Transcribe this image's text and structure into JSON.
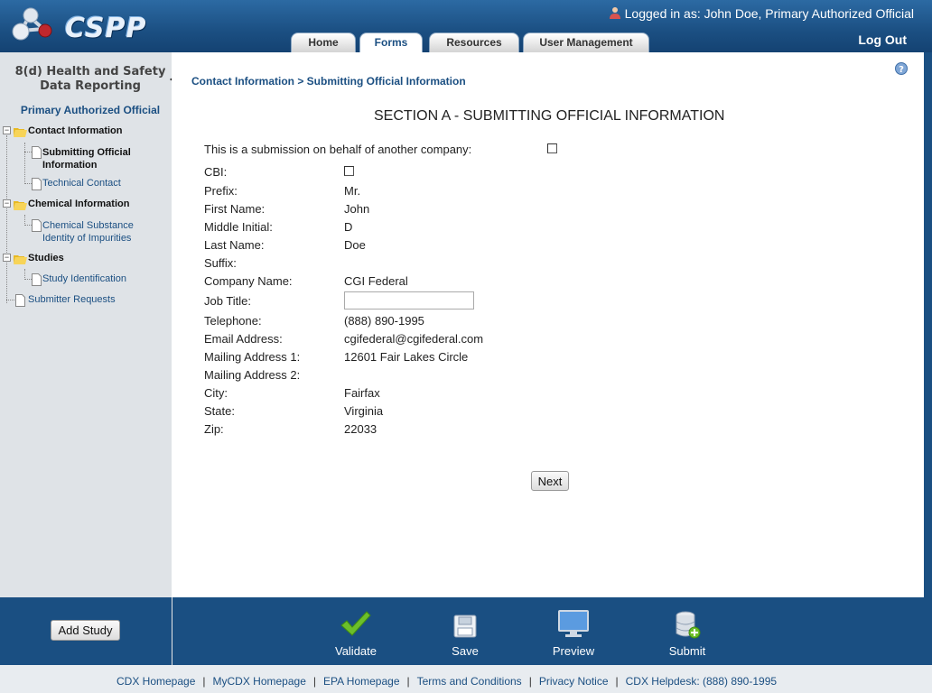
{
  "header": {
    "logo_text": "CSPP",
    "logged_in": "Logged in as: John Doe, Primary Authorized Official",
    "logout": "Log Out",
    "tabs": [
      "Home",
      "Forms",
      "Resources",
      "User Management"
    ],
    "active_tab": "Forms"
  },
  "sidebar": {
    "title_line1": "8(d) Health and Safety",
    "title_line2": "Data Reporting",
    "role": "Primary Authorized Official",
    "tree": {
      "contact_information": "Contact Information",
      "submitting_official_1": "Submitting Official",
      "submitting_official_2": "Information",
      "technical_contact": "Technical Contact",
      "chemical_information": "Chemical Information",
      "chemical_substance_1": "Chemical Substance",
      "chemical_substance_2": "Identity of Impurities",
      "studies": "Studies",
      "study_identification": "Study Identification",
      "submitter_requests": "Submitter Requests"
    }
  },
  "main": {
    "breadcrumb": "Contact Information > Submitting Official Information",
    "section_title": "SECTION A - SUBMITTING OFFICIAL INFORMATION",
    "behalf_label": "This is a submission on behalf of another company:",
    "fields": {
      "cbi": "CBI:",
      "prefix_label": "Prefix:",
      "prefix_value": "Mr.",
      "first_name_label": "First Name:",
      "first_name_value": "John",
      "middle_initial_label": "Middle Initial:",
      "middle_initial_value": "D",
      "last_name_label": "Last Name:",
      "last_name_value": "Doe",
      "suffix_label": "Suffix:",
      "company_label": "Company Name:",
      "company_value": "CGI Federal",
      "job_title_label": "Job Title:",
      "job_title_value": "",
      "telephone_label": "Telephone:",
      "telephone_value": "(888) 890-1995",
      "email_label": "Email Address:",
      "email_value": "cgifederal@cgifederal.com",
      "mailing1_label": "Mailing Address 1:",
      "mailing1_value": "12601 Fair Lakes Circle",
      "mailing2_label": "Mailing Address 2:",
      "city_label": "City:",
      "city_value": "Fairfax",
      "state_label": "State:",
      "state_value": "Virginia",
      "zip_label": "Zip:",
      "zip_value": "22033"
    },
    "next_button": "Next"
  },
  "toolbar": {
    "add_study": "Add Study",
    "validate": "Validate",
    "save": "Save",
    "preview": "Preview",
    "submit": "Submit"
  },
  "footer_links": {
    "cdx_home": "CDX Homepage",
    "mycdx_home": "MyCDX Homepage",
    "epa_home": "EPA Homepage",
    "terms": "Terms and Conditions",
    "privacy": "Privacy Notice",
    "helpdesk": "CDX Helpdesk: (888) 890-1995"
  },
  "colors": {
    "header_blue": "#1b4f82",
    "sidebar_bg": "#dfe3e7",
    "link_blue": "#1b4f82",
    "validate_green": "#6cbf2a"
  }
}
